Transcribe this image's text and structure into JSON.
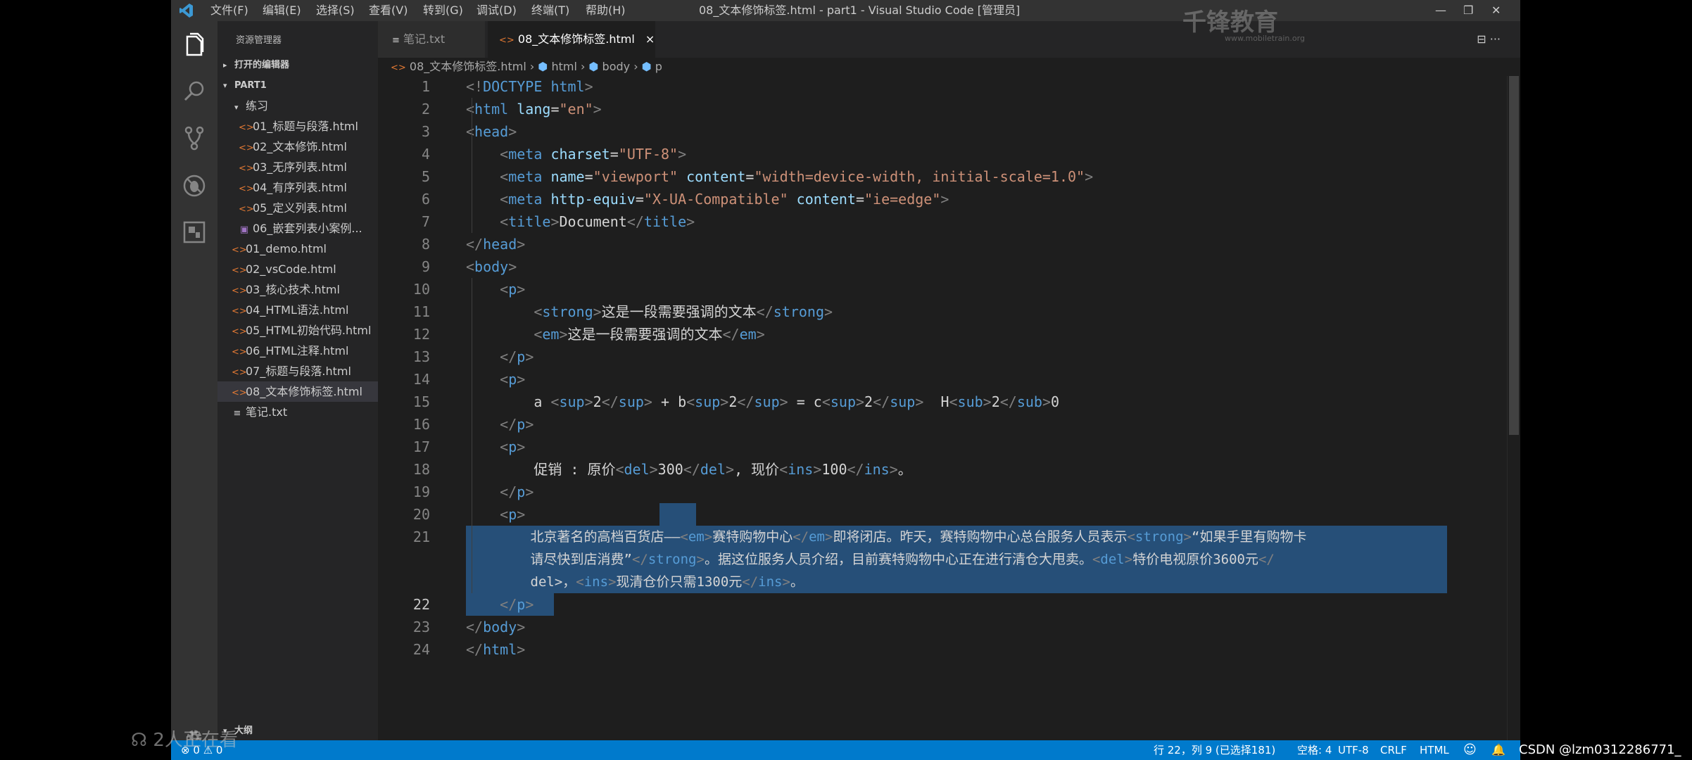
{
  "window": {
    "title": "08_文本修饰标签.html - part1 - Visual Studio Code [管理员]",
    "menu": [
      "文件(F)",
      "编辑(E)",
      "选择(S)",
      "查看(V)",
      "转到(G)",
      "调试(D)",
      "终端(T)",
      "帮助(H)"
    ]
  },
  "watermark": {
    "brand": "千锋教育",
    "url": "www.mobiletrain.org"
  },
  "sidebar": {
    "header": "资源管理器",
    "open_editors": "打开的编辑器",
    "root": "PART1",
    "folder": "练习",
    "folder_items": [
      "01_标题与段落.html",
      "02_文本修饰.html",
      "03_无序列表.html",
      "04_有序列表.html",
      "05_定义列表.html",
      "06_嵌套列表小案例..."
    ],
    "root_items": [
      "01_demo.html",
      "02_vsCode.html",
      "03_核心技术.html",
      "04_HTML语法.html",
      "05_HTML初始代码.html",
      "06_HTML注释.html",
      "07_标题与段落.html",
      "08_文本修饰标签.html",
      "笔记.txt"
    ],
    "outline": "大纲"
  },
  "tabs": [
    {
      "label": "笔记.txt",
      "active": false
    },
    {
      "label": "08_文本修饰标签.html",
      "active": true,
      "close": "×"
    }
  ],
  "tab_actions": "⊟ ···",
  "breadcrumb": [
    "08_文本修饰标签.html",
    "html",
    "body",
    "p"
  ],
  "editor": {
    "line_numbers": [
      "1",
      "2",
      "3",
      "4",
      "5",
      "6",
      "7",
      "8",
      "9",
      "10",
      "11",
      "12",
      "13",
      "14",
      "15",
      "16",
      "17",
      "18",
      "19",
      "20",
      "21",
      "",
      "",
      "22",
      "23",
      "24"
    ],
    "cursor_line": "22"
  },
  "statusbar": {
    "errors": "0",
    "warnings": "0",
    "position": "行 22，列 9 (已选择181)",
    "spaces": "空格: 4",
    "encoding": "UTF-8",
    "eol": "CRLF",
    "language": "HTML"
  },
  "overlay": {
    "viewers": "2人正在看",
    "credit": "CSDN @lzm0312286771_"
  },
  "colors": {
    "statusbar": "#007acc",
    "selection": "#264f78",
    "tag": "#569cd6",
    "attribute": "#9cdcfe",
    "string": "#ce9178"
  }
}
